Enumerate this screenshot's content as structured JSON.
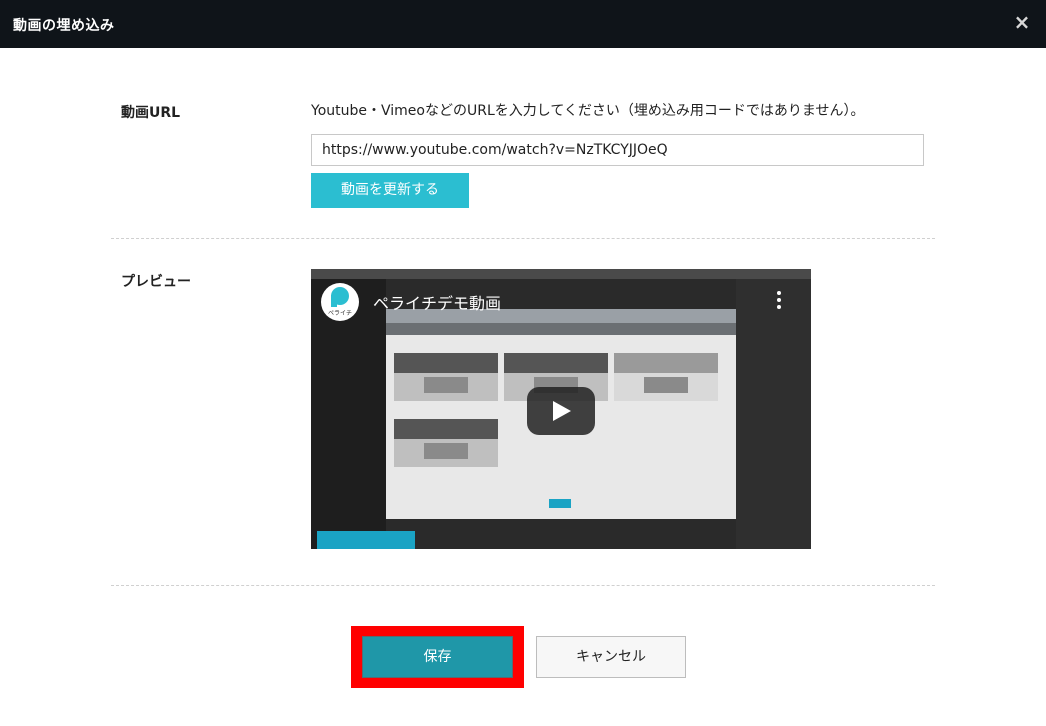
{
  "header": {
    "title": "動画の埋め込み",
    "close_icon": "close-icon",
    "close_glyph": "×"
  },
  "video_url": {
    "label": "動画URL",
    "help_text": "Youtube・VimeoなどのURLを入力してください（埋め込み用コードではありません）。",
    "value": "https://www.youtube.com/watch?v=NzTKCYJJOeQ",
    "update_button_label": "動画を更新する"
  },
  "preview": {
    "label": "プレビュー",
    "video_title": "ペライチデモ動画",
    "channel_logo_text": "ペライチ",
    "play_icon": "play-icon",
    "menu_icon": "more-vertical-icon"
  },
  "footer": {
    "save_label": "保存",
    "cancel_label": "キャンセル"
  },
  "colors": {
    "header_bg": "#0f1419",
    "accent": "#2bbed1",
    "save_button": "#1f97a8",
    "highlight_frame": "#ff0000"
  }
}
